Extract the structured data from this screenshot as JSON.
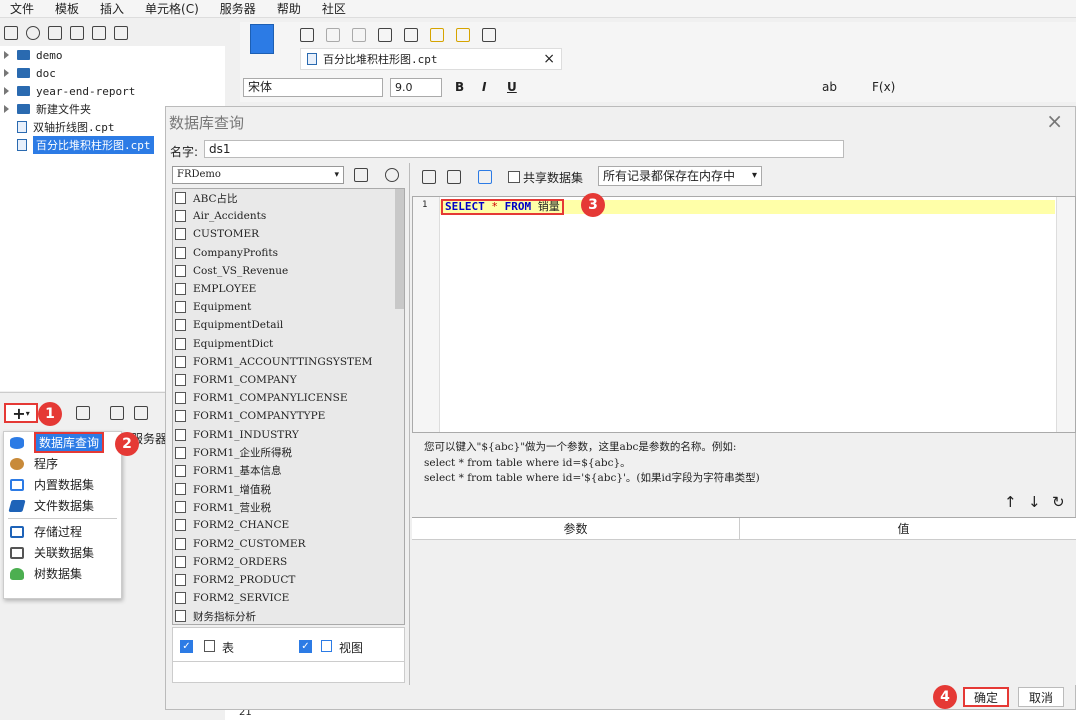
{
  "menubar": [
    "文件",
    "模板",
    "插入",
    "单元格(C)",
    "服务器",
    "帮助",
    "社区"
  ],
  "file_tree": {
    "folders": [
      "demo",
      "doc",
      "year-end-report",
      "新建文件夹"
    ],
    "files": [
      "双轴折线图.cpt",
      "百分比堆积柱形图.cpt"
    ]
  },
  "editor_tab": {
    "label": "百分比堆积柱形图.cpt",
    "close": "×"
  },
  "format_toolbar": {
    "font": "宋体",
    "size": "9.0",
    "bold": "B",
    "italic": "I",
    "underline": "U",
    "ab": "ab",
    "fx": "F(x)"
  },
  "ruler_row": "21",
  "server_label_fragment": "服务器",
  "ds_menu": {
    "items": [
      "数据库查询",
      "程序",
      "内置数据集",
      "文件数据集",
      "存储过程",
      "关联数据集",
      "树数据集"
    ]
  },
  "badges": [
    "1",
    "2",
    "3",
    "4"
  ],
  "dialog": {
    "title": "数据库查询",
    "close": "×",
    "name_label": "名字:",
    "name_value": "ds1",
    "connection": "FRDemo",
    "tables": [
      "ABC占比",
      "Air_Accidents",
      "CUSTOMER",
      "CompanyProfits",
      "Cost_VS_Revenue",
      "EMPLOYEE",
      "Equipment",
      "EquipmentDetail",
      "EquipmentDict",
      "FORM1_ACCOUNTTINGSYSTEM",
      "FORM1_COMPANY",
      "FORM1_COMPANYLICENSE",
      "FORM1_COMPANYTYPE",
      "FORM1_INDUSTRY",
      "FORM1_企业所得税",
      "FORM1_基本信息",
      "FORM1_增值税",
      "FORM1_营业税",
      "FORM2_CHANCE",
      "FORM2_CUSTOMER",
      "FORM2_ORDERS",
      "FORM2_PRODUCT",
      "FORM2_SERVICE",
      "财务指标分析"
    ],
    "filter_table": "表",
    "filter_view": "视图",
    "share_label": "共享数据集",
    "memory_option": "所有记录都保存在内存中",
    "sql_line_no": "1",
    "sql": {
      "kw1": "SELECT",
      "star": "*",
      "kw2": "FROM",
      "table": "销量"
    },
    "hint_lines": [
      "您可以键入\"${abc}\"做为一个参数，这里abc是参数的名称。例如:",
      "select * from table where id=${abc}。",
      "select * from table where id='${abc}'。(如果id字段为字符串类型)"
    ],
    "param_header": [
      "参数",
      "值"
    ],
    "ok": "确定",
    "cancel": "取消"
  }
}
